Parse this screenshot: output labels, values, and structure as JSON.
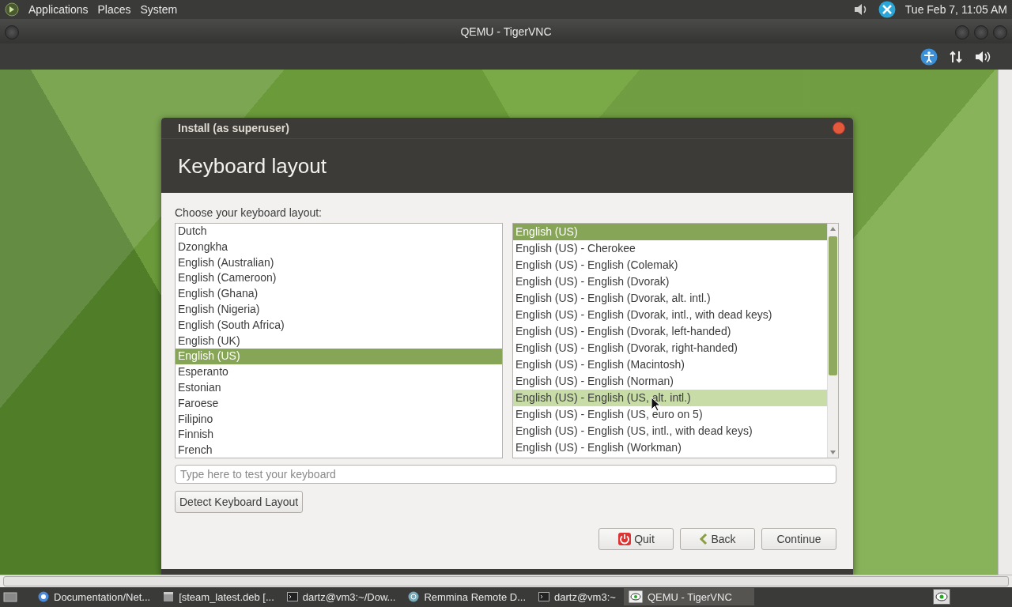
{
  "top_panel": {
    "menus": [
      "Applications",
      "Places",
      "System"
    ],
    "clock": "Tue Feb 7, 11:05 AM"
  },
  "vnc_window": {
    "title": "QEMU - TigerVNC"
  },
  "dialog": {
    "title": "Install (as superuser)",
    "heading": "Keyboard layout",
    "prompt": "Choose your keyboard layout:",
    "layouts": [
      {
        "label": "Dutch",
        "selected": false
      },
      {
        "label": "Dzongkha",
        "selected": false
      },
      {
        "label": "English (Australian)",
        "selected": false
      },
      {
        "label": "English (Cameroon)",
        "selected": false
      },
      {
        "label": "English (Ghana)",
        "selected": false
      },
      {
        "label": "English (Nigeria)",
        "selected": false
      },
      {
        "label": "English (South Africa)",
        "selected": false
      },
      {
        "label": "English (UK)",
        "selected": false
      },
      {
        "label": "English (US)",
        "selected": true
      },
      {
        "label": "Esperanto",
        "selected": false
      },
      {
        "label": "Estonian",
        "selected": false
      },
      {
        "label": "Faroese",
        "selected": false
      },
      {
        "label": "Filipino",
        "selected": false
      },
      {
        "label": "Finnish",
        "selected": false
      },
      {
        "label": "French",
        "selected": false
      }
    ],
    "variants": [
      {
        "label": "English (US)",
        "selected": true,
        "hovered": false
      },
      {
        "label": "English (US) - Cherokee",
        "selected": false,
        "hovered": false
      },
      {
        "label": "English (US) - English (Colemak)",
        "selected": false,
        "hovered": false
      },
      {
        "label": "English (US) - English (Dvorak)",
        "selected": false,
        "hovered": false
      },
      {
        "label": "English (US) - English (Dvorak, alt. intl.)",
        "selected": false,
        "hovered": false
      },
      {
        "label": "English (US) - English (Dvorak, intl., with dead keys)",
        "selected": false,
        "hovered": false
      },
      {
        "label": "English (US) - English (Dvorak, left-handed)",
        "selected": false,
        "hovered": false
      },
      {
        "label": "English (US) - English (Dvorak, right-handed)",
        "selected": false,
        "hovered": false
      },
      {
        "label": "English (US) - English (Macintosh)",
        "selected": false,
        "hovered": false
      },
      {
        "label": "English (US) - English (Norman)",
        "selected": false,
        "hovered": false
      },
      {
        "label": "English (US) - English (US, alt. intl.)",
        "selected": false,
        "hovered": true
      },
      {
        "label": "English (US) - English (US, euro on 5)",
        "selected": false,
        "hovered": false
      },
      {
        "label": "English (US) - English (US, intl., with dead keys)",
        "selected": false,
        "hovered": false
      },
      {
        "label": "English (US) - English (Workman)",
        "selected": false,
        "hovered": false
      }
    ],
    "test_field": {
      "placeholder": "Type here to test your keyboard"
    },
    "detect_button": "Detect Keyboard Layout",
    "buttons": [
      {
        "kind": "quit",
        "label": "Quit"
      },
      {
        "kind": "back",
        "label": "Back"
      },
      {
        "kind": "continue",
        "label": "Continue"
      }
    ]
  },
  "taskbar": {
    "items": [
      {
        "kind": "browser",
        "label": "Documentation/Net...",
        "selected": false
      },
      {
        "kind": "package",
        "label": "[steam_latest.deb [...",
        "selected": false
      },
      {
        "kind": "terminal",
        "label": "dartz@vm3:~/Dow...",
        "selected": false
      },
      {
        "kind": "remote",
        "label": "Remmina Remote D...",
        "selected": false
      },
      {
        "kind": "terminal",
        "label": "dartz@vm3:~",
        "selected": false
      },
      {
        "kind": "vnc",
        "label": "QEMU - TigerVNC",
        "selected": true
      }
    ]
  }
}
